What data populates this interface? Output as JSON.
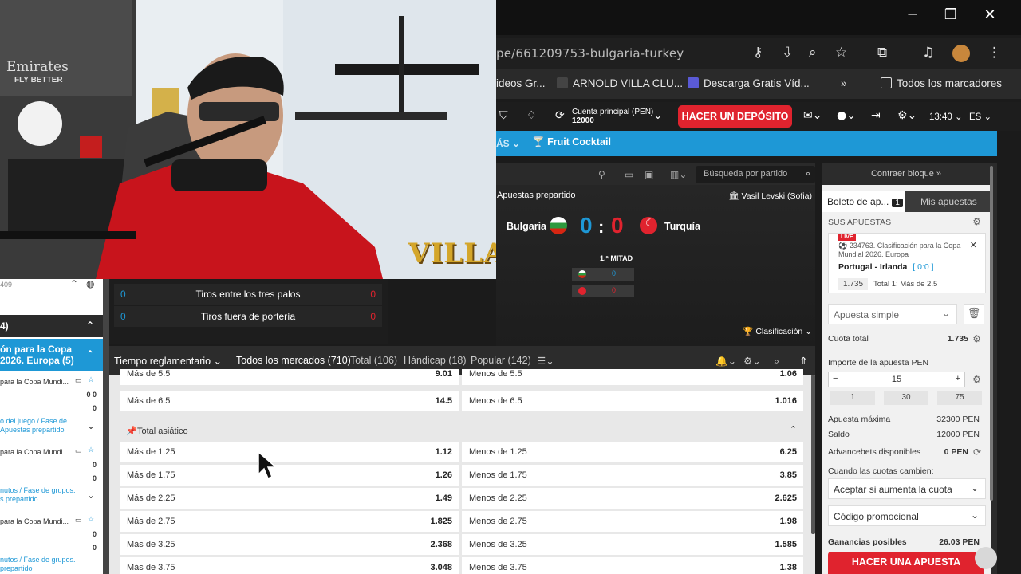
{
  "browser": {
    "url": "pe/661209753-bulgaria-turkey",
    "bookmarks": [
      "ideos Gr...",
      "ARNOLD VILLA CLU...",
      "Descarga Gratis Víd...",
      "Todos los marcadores"
    ],
    "bookmark_more": "»"
  },
  "header": {
    "account_label": "Cuenta principal (PEN)",
    "account_value": "12000",
    "deposit_label": "HACER UN DEPÓSITO",
    "time": "13:40",
    "lang": "ES"
  },
  "menu": {
    "more": "ÁS",
    "cocktail": "Fruit Cocktail"
  },
  "match": {
    "search_placeholder": "Búsqueda por partido",
    "prematch": "Apuestas prepartido",
    "stadium": "Vasil Levski (Sofia)",
    "home": "Bulgaria",
    "away": "Turquía",
    "home_score": "0",
    "away_score": "0",
    "separator": ":",
    "half": "1.ª MITAD",
    "mini_home": "0",
    "mini_away": "0",
    "clasificacion": "Clasificación"
  },
  "stats": [
    {
      "label": "Tiros entre los tres palos",
      "home": "0",
      "away": "0"
    },
    {
      "label": "Tiros fuera de portería",
      "home": "0",
      "away": "0"
    }
  ],
  "left_panel": {
    "top_text": "409",
    "count_header": "4)",
    "blue_title_1": "ón para la Copa",
    "blue_title_2": "2026. Europa (5)",
    "items": [
      {
        "title": "para la Copa Mundi...",
        "s1": "0 0",
        "s2": "0"
      },
      {
        "link1": "o del juego / Fase de",
        "link2": "Apuestas prepartido"
      },
      {
        "title": "para la Copa Mundi...",
        "s1": "0",
        "s2": "0"
      },
      {
        "link1": "nutos / Fase de grupos.",
        "link2": "s prepartido"
      },
      {
        "title": "para la Copa Mundi...",
        "s1": "0",
        "s2": "0"
      },
      {
        "link1": "nutos / Fase de grupos.",
        "link2": "prepartido"
      }
    ]
  },
  "tabs": {
    "period": "Tiempo reglamentario",
    "all": "Todos los mercados (710)",
    "total": "Total (106)",
    "handicap": "Hándicap (18)",
    "popular": "Popular (142)"
  },
  "markets": {
    "top_rows": [
      {
        "over": "Más de 5.5",
        "over_odd": "9.01",
        "under": "Menos de 5.5",
        "under_odd": "1.06"
      },
      {
        "over": "Más de 6.5",
        "over_odd": "14.5",
        "under": "Menos de 6.5",
        "under_odd": "1.016"
      }
    ],
    "group_title": "Total asiático",
    "asian_rows": [
      {
        "over": "Más de 1.25",
        "over_odd": "1.12",
        "under": "Menos de 1.25",
        "under_odd": "6.25"
      },
      {
        "over": "Más de 1.75",
        "over_odd": "1.26",
        "under": "Menos de 1.75",
        "under_odd": "3.85"
      },
      {
        "over": "Más de 2.25",
        "over_odd": "1.49",
        "under": "Menos de 2.25",
        "under_odd": "2.625"
      },
      {
        "over": "Más de 2.75",
        "over_odd": "1.825",
        "under": "Menos de 2.75",
        "under_odd": "1.98"
      },
      {
        "over": "Más de 3.25",
        "over_odd": "2.368",
        "under": "Menos de 3.25",
        "under_odd": "1.585"
      },
      {
        "over": "Más de 3.75",
        "over_odd": "3.048",
        "under": "Menos de 3.75",
        "under_odd": "1.38"
      }
    ]
  },
  "slip": {
    "collapse": "Contraer bloque »",
    "tab_slip": "Boleto de ap...",
    "tab_count": "1",
    "tab_my": "Mis apuestas",
    "your_bets": "SUS APUESTAS",
    "live": "LIVE",
    "bet_name": "234763. Clasificación para la Copa Mundial 2026. Europa",
    "bet_match": "Portugal - Irlanda",
    "bet_score": "[ 0:0 ]",
    "bet_odds": "1.735",
    "bet_selection": "Total 1: Más de 2.5",
    "bet_type": "Apuesta simple",
    "total_odds_label": "Cuota total",
    "total_odds": "1.735",
    "stake_label": "Importe de la apuesta PEN",
    "stake_value": "15",
    "quick": [
      "1",
      "30",
      "75"
    ],
    "max_label": "Apuesta máxima",
    "max_value": "32300 PEN",
    "balance_label": "Saldo",
    "balance_value": "12000 PEN",
    "advance_label": "Advancebets disponibles",
    "advance_value": "0 PEN",
    "odds_change_label": "Cuando las cuotas cambien:",
    "odds_change_value": "Aceptar si aumenta la cuota",
    "promo": "Código promocional",
    "winnings_label": "Ganancias posibles",
    "winnings_value": "26.03 PEN",
    "place_bet": "HACER UNA APUESTA"
  },
  "webcam": {
    "overlay_text": "VILLA",
    "banner_brand": "Emirates",
    "banner_tag": "FLY BETTER"
  },
  "colors": {
    "accent_red": "#e0232e",
    "accent_blue": "#1e98d6",
    "score_blue": "#1e98d6",
    "score_red": "#e0232e"
  }
}
